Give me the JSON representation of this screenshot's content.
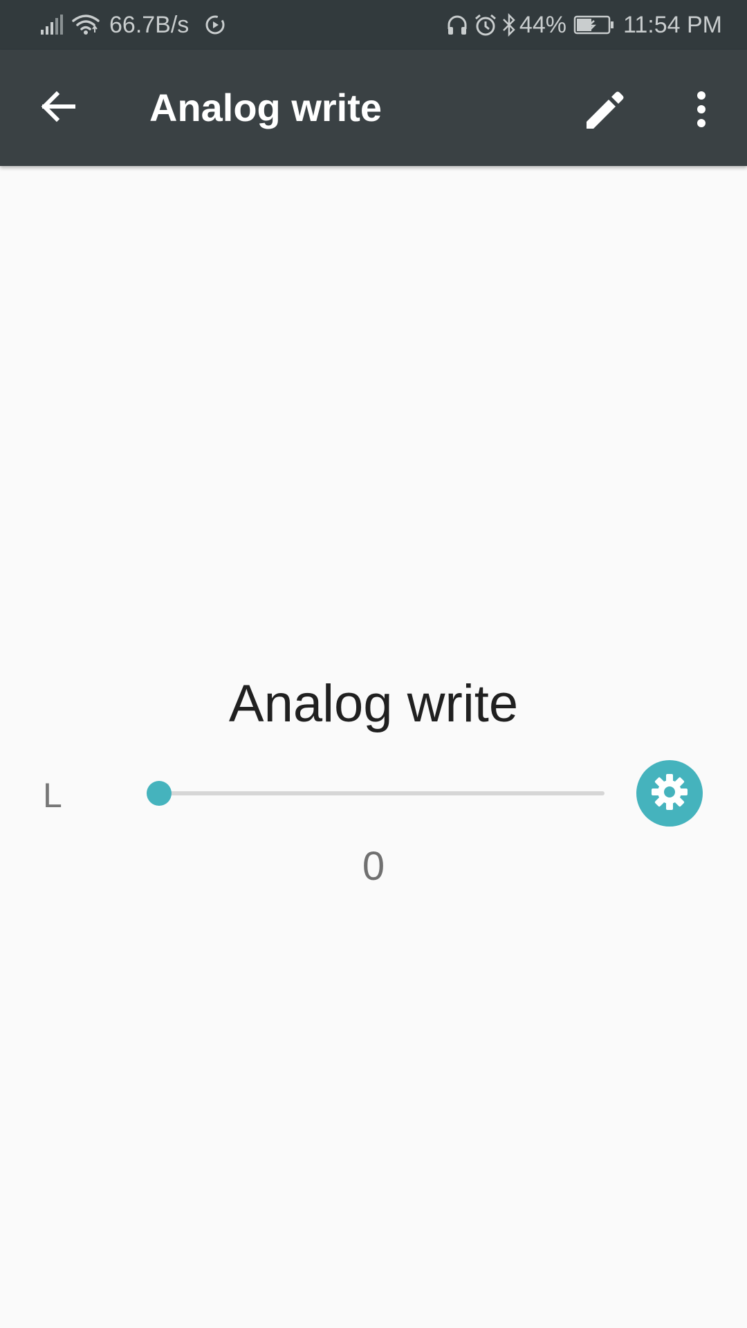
{
  "status_bar": {
    "network_speed": "66.7B/s",
    "battery_percent": "44%",
    "time": "11:54 PM",
    "icons": [
      "signal-icon",
      "wifi-icon",
      "sync-icon",
      "headphones-icon",
      "alarm-icon",
      "bluetooth-icon",
      "battery-charging-icon"
    ]
  },
  "app_bar": {
    "title": "Analog write",
    "icons": [
      "back-arrow-icon",
      "pencil-icon",
      "more-vert-icon"
    ]
  },
  "widget": {
    "title": "Analog write",
    "pin_label": "L",
    "value": "0",
    "slider_fraction": 0,
    "settings_icon": "gear-icon"
  },
  "colors": {
    "status_bar_bg": "#323a3d",
    "app_bar_bg": "#3a4144",
    "background": "#fafafa",
    "accent": "#45b3bd",
    "track": "#d6d6d6"
  }
}
